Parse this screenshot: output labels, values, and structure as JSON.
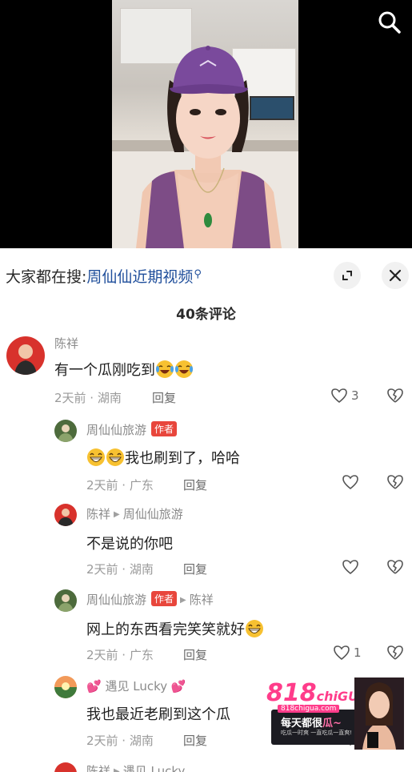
{
  "search": {
    "prefix": "大家都在搜:",
    "term": "周仙仙近期视频"
  },
  "comments_header": "40条评论",
  "comments": [
    {
      "author": "陈祥",
      "text": "有一个瓜刚吃到",
      "emojis": [
        "crying-laughing-emoji",
        "crying-laughing-emoji"
      ],
      "time_location": "2天前 · 湖南",
      "reply": "回复",
      "likes": "3"
    },
    {
      "author": "周仙仙旅游",
      "badge": "作者",
      "text": "我也刷到了，哈哈",
      "emojis_before": [
        "grinning-emoji",
        "grinning-emoji"
      ],
      "time_location": "2天前 · 广东",
      "reply": "回复"
    },
    {
      "author": "陈祥",
      "reply_to": "周仙仙旅游",
      "text": "不是说的你吧",
      "time_location": "2天前 · 湖南",
      "reply": "回复"
    },
    {
      "author": "周仙仙旅游",
      "badge": "作者",
      "reply_to": "陈祥",
      "text": "网上的东西看完笑笑就好",
      "emojis": [
        "grinning-emoji"
      ],
      "time_location": "2天前 · 广东",
      "reply": "回复",
      "likes": "1"
    },
    {
      "author": "遇见 Lucky",
      "author_decor": "💕",
      "text": "我也最近老刷到这个瓜",
      "time_location": "2天前 · 湖南",
      "reply": "回复"
    }
  ],
  "next_peek": {
    "author": "陈祥",
    "reply_to": "遇见 Lucky"
  },
  "promo": {
    "logo_number": "818",
    "logo_word": "chiGUA",
    "site": "818chigua.com",
    "title_a": "每天都很",
    "title_b": "瓜~",
    "sub": "吃瓜一时爽 一直吃瓜一直爽!"
  },
  "colors": {
    "link_blue": "#1f4e9b",
    "author_badge": "#e8463c",
    "promo_pink": "#ff3c8a"
  }
}
